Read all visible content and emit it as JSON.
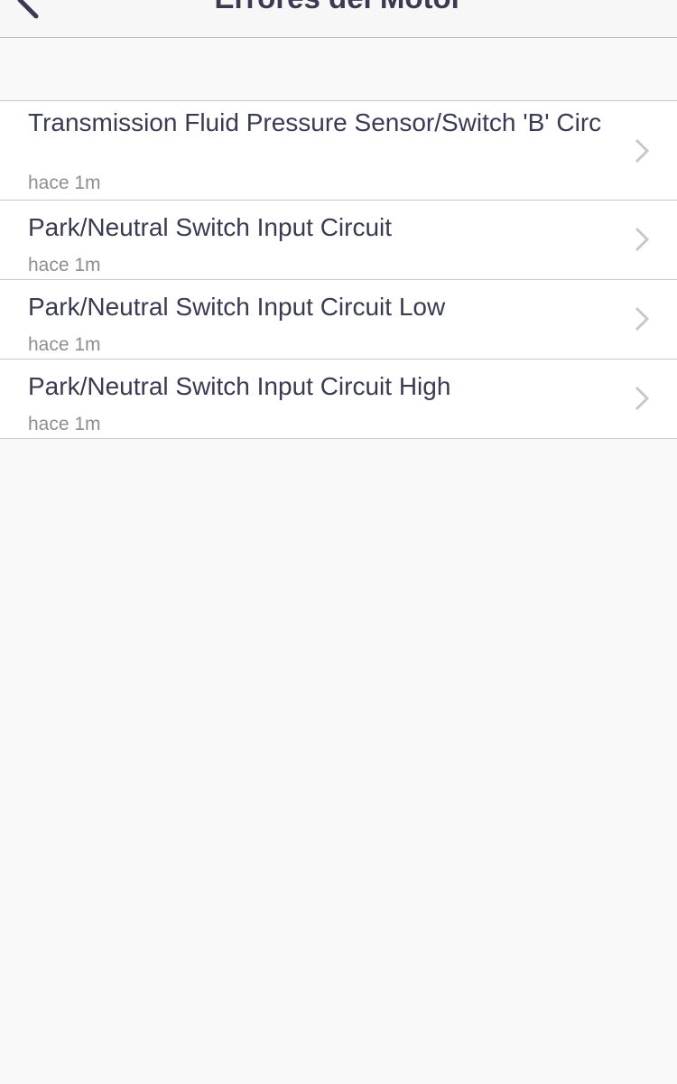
{
  "navbar": {
    "title": "Errores del Motor",
    "back_icon": "chevron-left-icon"
  },
  "errors": [
    {
      "title": "Transmission Fluid Pressure Sensor/Switch 'B' Circ",
      "time": "hace 1m"
    },
    {
      "title": "Park/Neutral Switch Input Circuit",
      "time": "hace 1m"
    },
    {
      "title": "Park/Neutral Switch Input Circuit Low",
      "time": "hace 1m"
    },
    {
      "title": "Park/Neutral Switch Input Circuit High",
      "time": "hace 1m"
    }
  ],
  "colors": {
    "text_primary": "#3a3b52",
    "text_secondary": "#8e8e93",
    "separator": "#c8c7cc",
    "background": "#f9f9f9",
    "chevron": "#c7c7cc"
  }
}
